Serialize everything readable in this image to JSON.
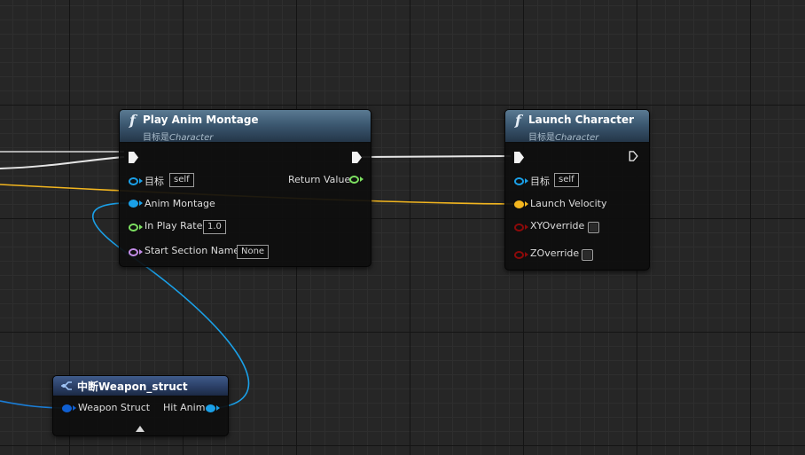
{
  "nodes": {
    "play_anim_montage": {
      "title": "Play Anim Montage",
      "target_prefix": "目标是",
      "target_class": "Character",
      "pins": {
        "target_label": "目标",
        "target_value": "self",
        "anim_montage_label": "Anim Montage",
        "in_play_rate_label": "In Play Rate",
        "in_play_rate_value": "1.0",
        "start_section_label": "Start Section Name",
        "start_section_value": "None",
        "return_value_label": "Return Value"
      }
    },
    "launch_character": {
      "title": "Launch Character",
      "target_prefix": "目标是",
      "target_class": "Character",
      "pins": {
        "target_label": "目标",
        "target_value": "self",
        "launch_velocity_label": "Launch Velocity",
        "xy_override_label": "XYOverride",
        "xy_override_checked": false,
        "z_override_label": "ZOverride",
        "z_override_checked": false
      }
    },
    "break_weapon_struct": {
      "title": "中断Weapon_struct",
      "pins": {
        "weapon_struct_label": "Weapon Struct",
        "hit_anim_label": "Hit Anim"
      }
    }
  },
  "colors": {
    "exec_wire": "#e6e6e6",
    "object_pin": "#1aa0e8",
    "vector_pin": "#f3b61f",
    "float_pin": "#7de061",
    "name_pin": "#c48de8",
    "bool_pin": "#8c0a0a",
    "struct_pin": "#0f5fd2"
  }
}
